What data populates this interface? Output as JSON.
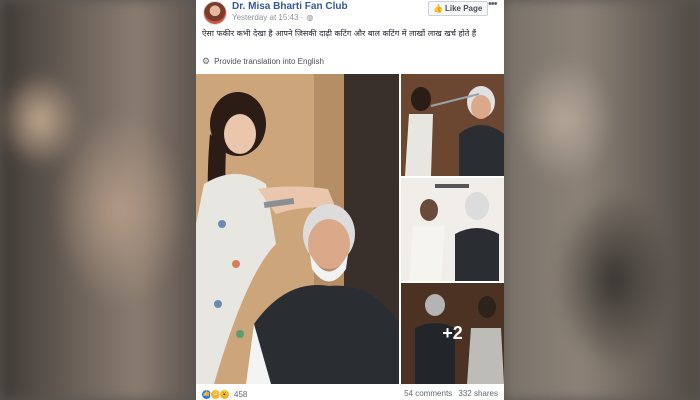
{
  "post": {
    "page_name": "Dr. Misa Bharti Fan Club",
    "timestamp": "Yesterday at 15:43 ·",
    "globe_icon": "globe-icon",
    "like_page_label": "Like Page",
    "text": "ऐसा फकीर कभी देखा है आपने जिसकी दाढ़ी कटिंग और बाल कटिंग में लाखों लाख खर्च होते हैं",
    "translate_label": "Provide translation into English",
    "photos": [
      {
        "name": "barber-trimming-hair"
      },
      {
        "name": "hair-measurement-1"
      },
      {
        "name": "hair-measurement-2"
      },
      {
        "name": "hair-measurement-3"
      }
    ],
    "more_photos_label": "+2",
    "reaction_count": "458",
    "comments": "54 comments",
    "shares": "332 shares"
  },
  "colors": {
    "link": "#365899",
    "like_blue": "#2078f4",
    "background": "#5b5652"
  }
}
